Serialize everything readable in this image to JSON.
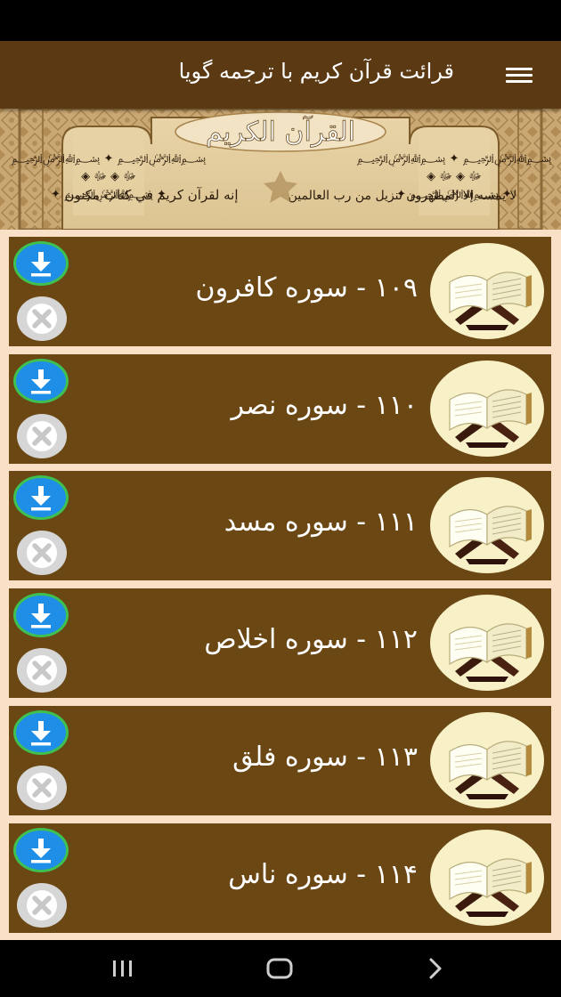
{
  "app_bar": {
    "title": "قرائت قرآن کریم با ترجمه گویا",
    "background": "#5a3913"
  },
  "banner": {
    "title_calligraphy": "القرآن الكريم",
    "left_calligraphy": "إنه لقرآن كريم في كتاب مكنون",
    "right_calligraphy": "لا يمسه إلا المطهرون تنزيل من رب العالمين"
  },
  "surah_list": [
    {
      "label": "۱۰۹ - سوره کافرون"
    },
    {
      "label": "۱۱۰ - سوره نصر"
    },
    {
      "label": "۱۱۱ - سوره مسد"
    },
    {
      "label": "۱۱۲ - سوره اخلاص"
    },
    {
      "label": "۱۱۳ - سوره فلق"
    },
    {
      "label": "۱۱۴ - سوره ناس"
    }
  ],
  "colors": {
    "card": "#6b4714",
    "list_background": "#fbe0c8",
    "download": "#1e8ee6",
    "download_ring": "#3fc050",
    "cancel": "#d6d6d6"
  },
  "icons": {
    "menu": "hamburger-menu-icon",
    "item": "quran-book-stand-icon",
    "download": "download-icon",
    "cancel": "close-icon",
    "nav_recents": "recent-apps-icon",
    "nav_home": "home-icon",
    "nav_back": "back-icon"
  }
}
